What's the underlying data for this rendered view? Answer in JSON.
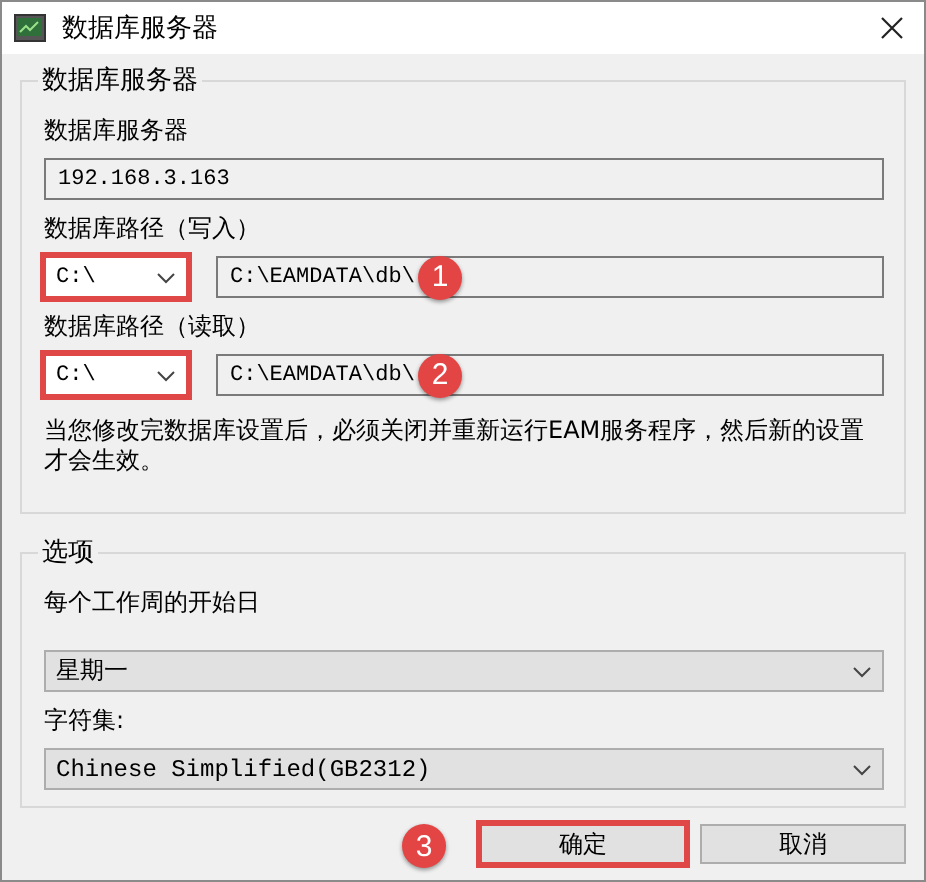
{
  "window": {
    "title": "数据库服务器"
  },
  "database_group": {
    "title": "数据库服务器",
    "server_label": "数据库服务器",
    "server_value": "192.168.3.163",
    "paths": [
      {
        "label": "数据库路径（写入）",
        "drive": "C:\\",
        "path": "C:\\EAMDATA\\db\\",
        "highlighted": true,
        "callout": "1"
      },
      {
        "label": "数据库路径（读取）",
        "drive": "C:\\",
        "path": "C:\\EAMDATA\\db\\",
        "highlighted": true,
        "callout": "2"
      }
    ],
    "note": "当您修改完数据库设置后，必须关闭并重新运行EAM服务程序，然后新的设置才会生效。"
  },
  "options_group": {
    "title": "选项",
    "week_start_label": "每个工作周的开始日",
    "week_start": "星期一",
    "charset_label": "字符集:",
    "charset": "Chinese Simplified(GB2312)"
  },
  "buttons": [
    {
      "label": "确定",
      "highlighted": true,
      "callout": "3"
    },
    {
      "label": "取消",
      "highlighted": false
    }
  ]
}
